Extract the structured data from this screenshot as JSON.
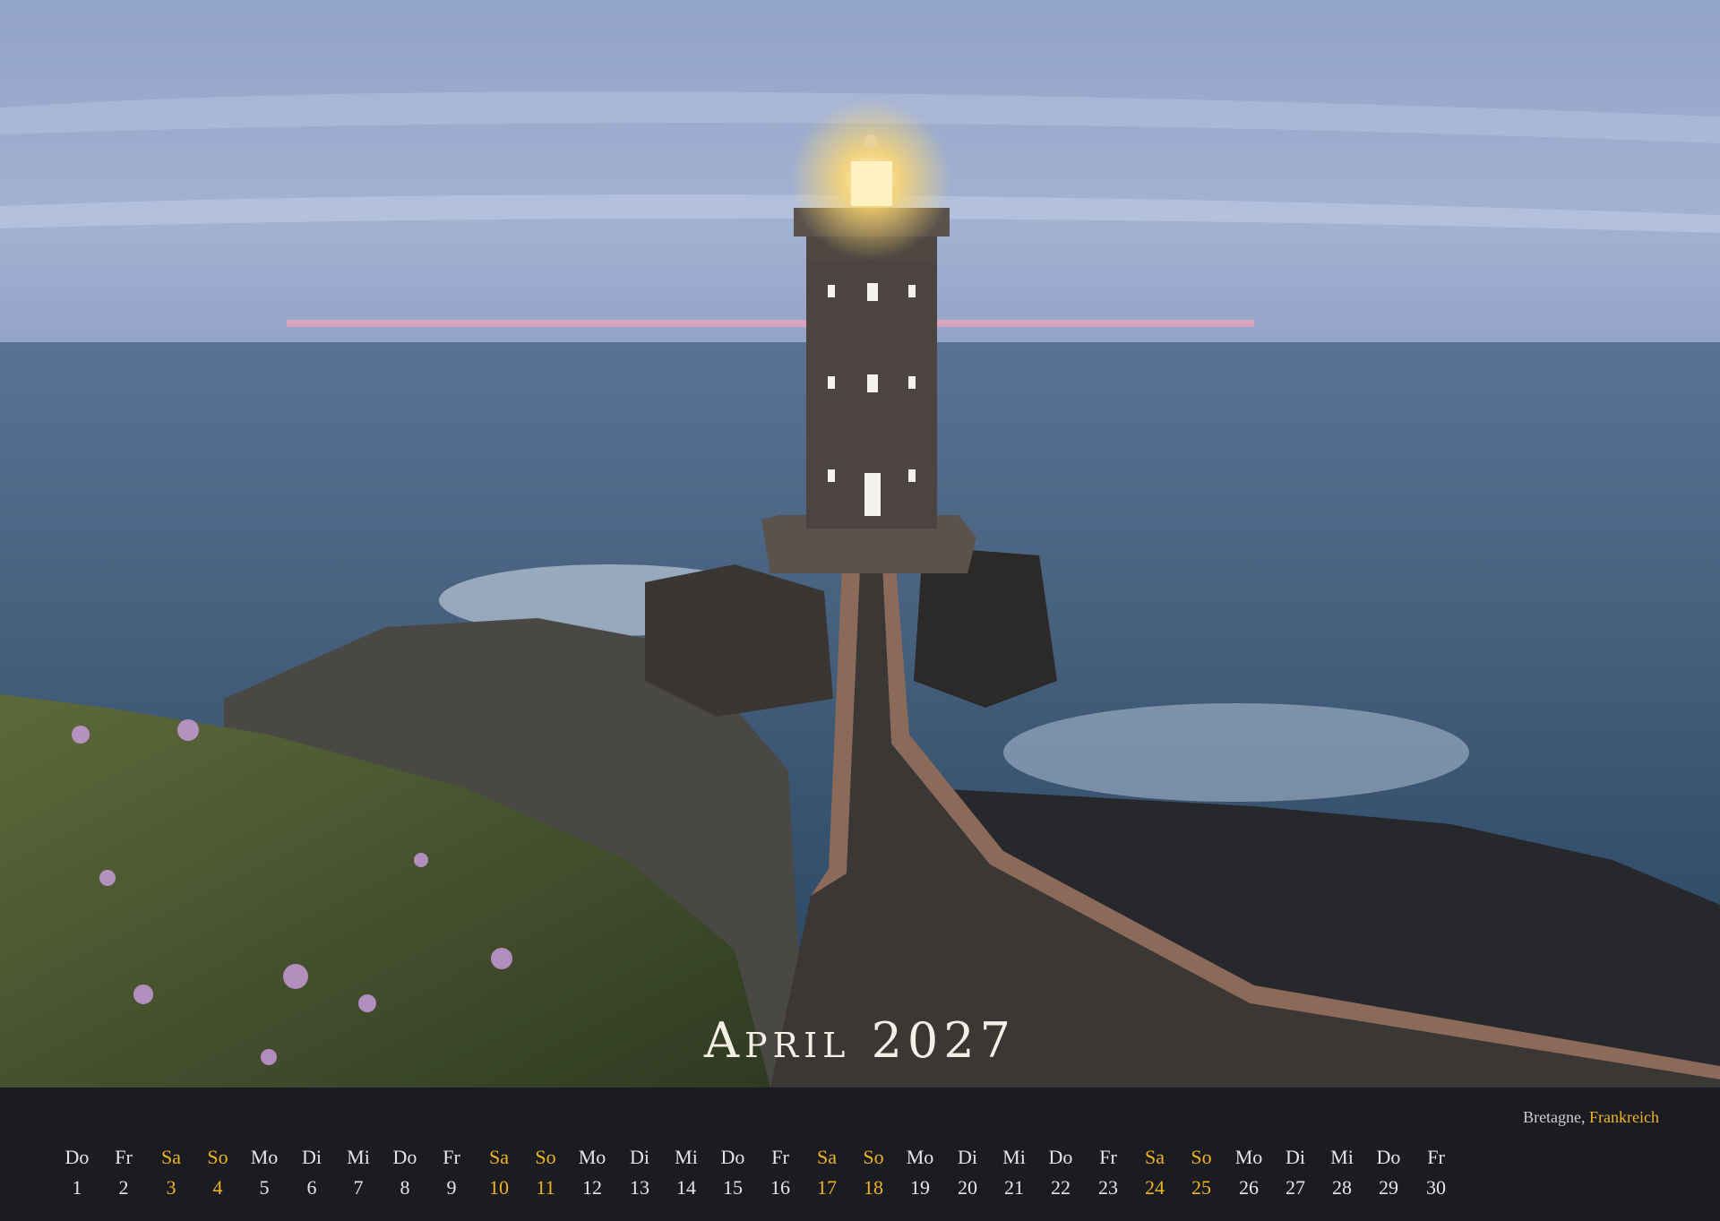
{
  "calendar": {
    "month_title": "April 2027",
    "location_region": "Bretagne,",
    "location_country": "Frankreich",
    "accent_color": "#f0b422",
    "days": [
      {
        "dow": "Do",
        "num": "1",
        "weekend": false
      },
      {
        "dow": "Fr",
        "num": "2",
        "weekend": false
      },
      {
        "dow": "Sa",
        "num": "3",
        "weekend": true
      },
      {
        "dow": "So",
        "num": "4",
        "weekend": true
      },
      {
        "dow": "Mo",
        "num": "5",
        "weekend": false
      },
      {
        "dow": "Di",
        "num": "6",
        "weekend": false
      },
      {
        "dow": "Mi",
        "num": "7",
        "weekend": false
      },
      {
        "dow": "Do",
        "num": "8",
        "weekend": false
      },
      {
        "dow": "Fr",
        "num": "9",
        "weekend": false
      },
      {
        "dow": "Sa",
        "num": "10",
        "weekend": true
      },
      {
        "dow": "So",
        "num": "11",
        "weekend": true
      },
      {
        "dow": "Mo",
        "num": "12",
        "weekend": false
      },
      {
        "dow": "Di",
        "num": "13",
        "weekend": false
      },
      {
        "dow": "Mi",
        "num": "14",
        "weekend": false
      },
      {
        "dow": "Do",
        "num": "15",
        "weekend": false
      },
      {
        "dow": "Fr",
        "num": "16",
        "weekend": false
      },
      {
        "dow": "Sa",
        "num": "17",
        "weekend": true
      },
      {
        "dow": "So",
        "num": "18",
        "weekend": true
      },
      {
        "dow": "Mo",
        "num": "19",
        "weekend": false
      },
      {
        "dow": "Di",
        "num": "20",
        "weekend": false
      },
      {
        "dow": "Mi",
        "num": "21",
        "weekend": false
      },
      {
        "dow": "Do",
        "num": "22",
        "weekend": false
      },
      {
        "dow": "Fr",
        "num": "23",
        "weekend": false
      },
      {
        "dow": "Sa",
        "num": "24",
        "weekend": true
      },
      {
        "dow": "So",
        "num": "25",
        "weekend": true
      },
      {
        "dow": "Mo",
        "num": "26",
        "weekend": false
      },
      {
        "dow": "Di",
        "num": "27",
        "weekend": false
      },
      {
        "dow": "Mi",
        "num": "28",
        "weekend": false
      },
      {
        "dow": "Do",
        "num": "29",
        "weekend": false
      },
      {
        "dow": "Fr",
        "num": "30",
        "weekend": false
      }
    ]
  }
}
